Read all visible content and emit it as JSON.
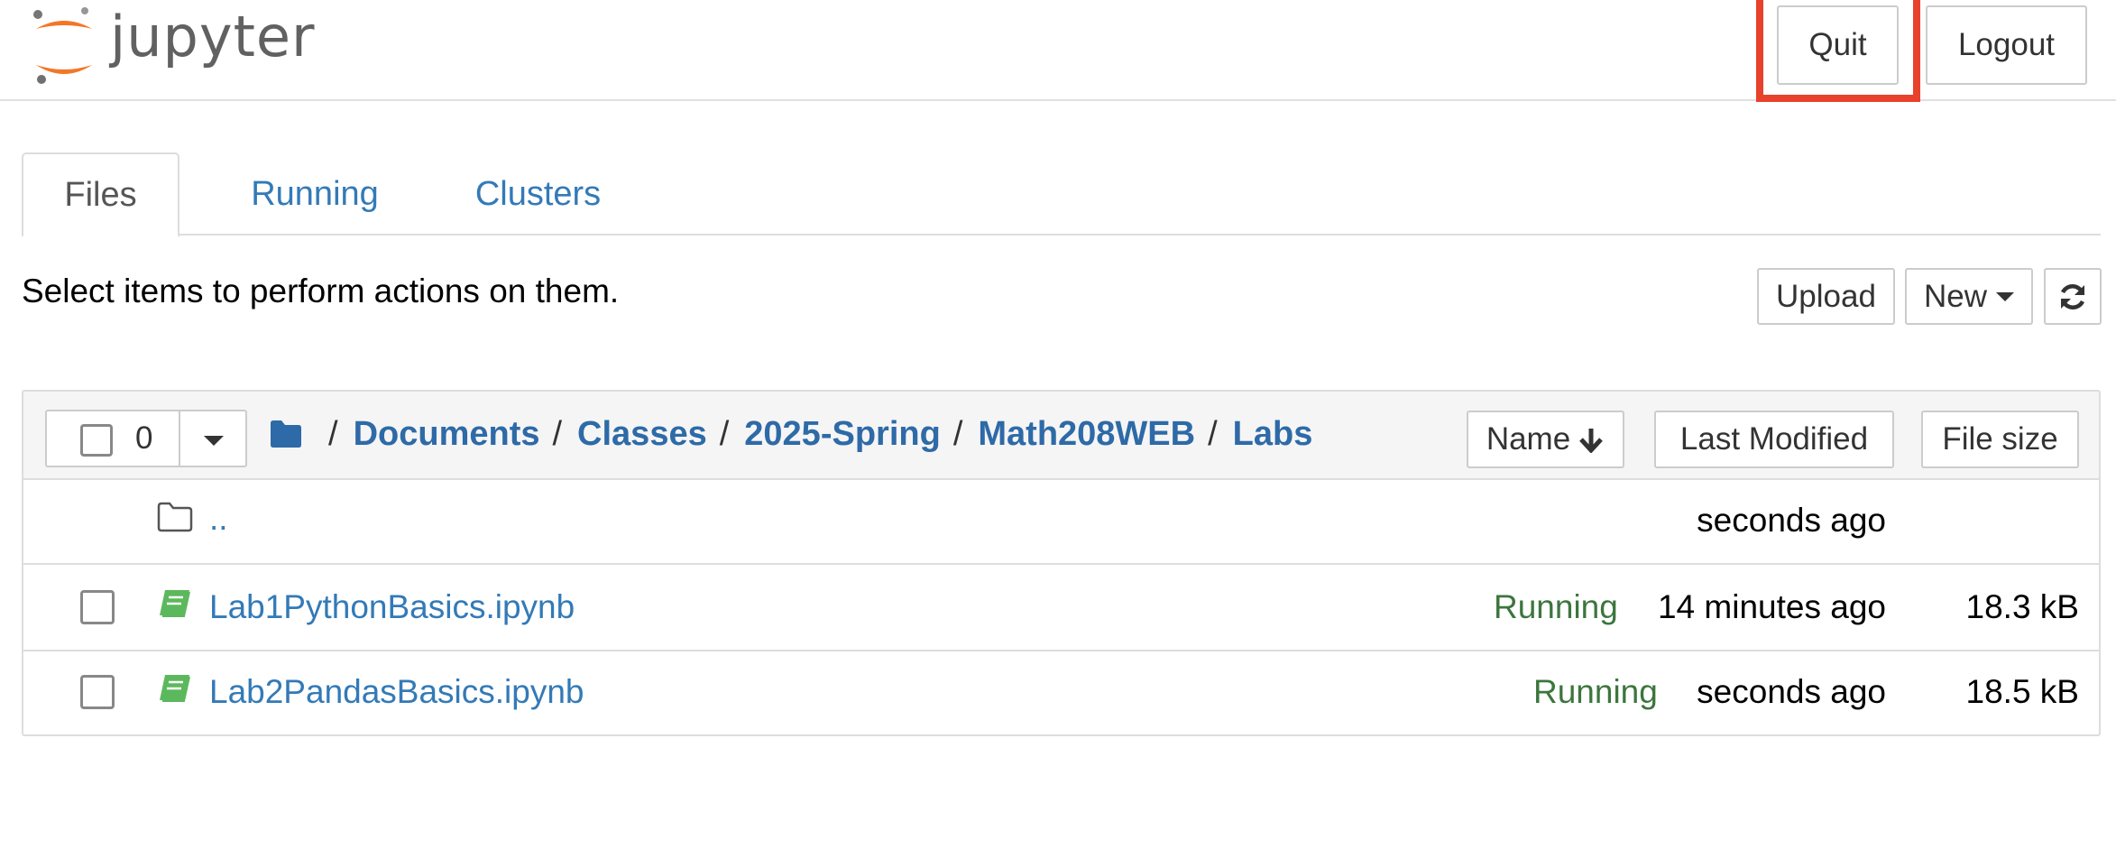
{
  "app": {
    "logo_text": "jupyter"
  },
  "header": {
    "quit_label": "Quit",
    "logout_label": "Logout",
    "highlight_color": "#e8412c"
  },
  "tabs": [
    {
      "label": "Files",
      "active": true
    },
    {
      "label": "Running",
      "active": false
    },
    {
      "label": "Clusters",
      "active": false
    }
  ],
  "toolbar": {
    "hint": "Select items to perform actions on them.",
    "upload_label": "Upload",
    "new_label": "New",
    "refresh_icon": "refresh-icon"
  },
  "list": {
    "selected_count": "0",
    "breadcrumb": [
      "Documents",
      "Classes",
      "2025-Spring",
      "Math208WEB",
      "Labs"
    ],
    "separator": "/",
    "sort_buttons": {
      "name": "Name",
      "last_modified": "Last Modified",
      "file_size": "File size"
    },
    "parent_row": {
      "name": "..",
      "modified": "seconds ago"
    },
    "rows": [
      {
        "name": "Lab1PythonBasics.ipynb",
        "status": "Running",
        "modified": "14 minutes ago",
        "size": "18.3 kB",
        "icon": "notebook-icon"
      },
      {
        "name": "Lab2PandasBasics.ipynb",
        "status": "Running",
        "modified": "seconds ago",
        "size": "18.5 kB",
        "icon": "notebook-icon"
      }
    ]
  },
  "colors": {
    "link": "#337ab7",
    "running": "#3c763d",
    "notebook_icon": "#5cb85c",
    "jupyter_orange": "#f37726"
  }
}
